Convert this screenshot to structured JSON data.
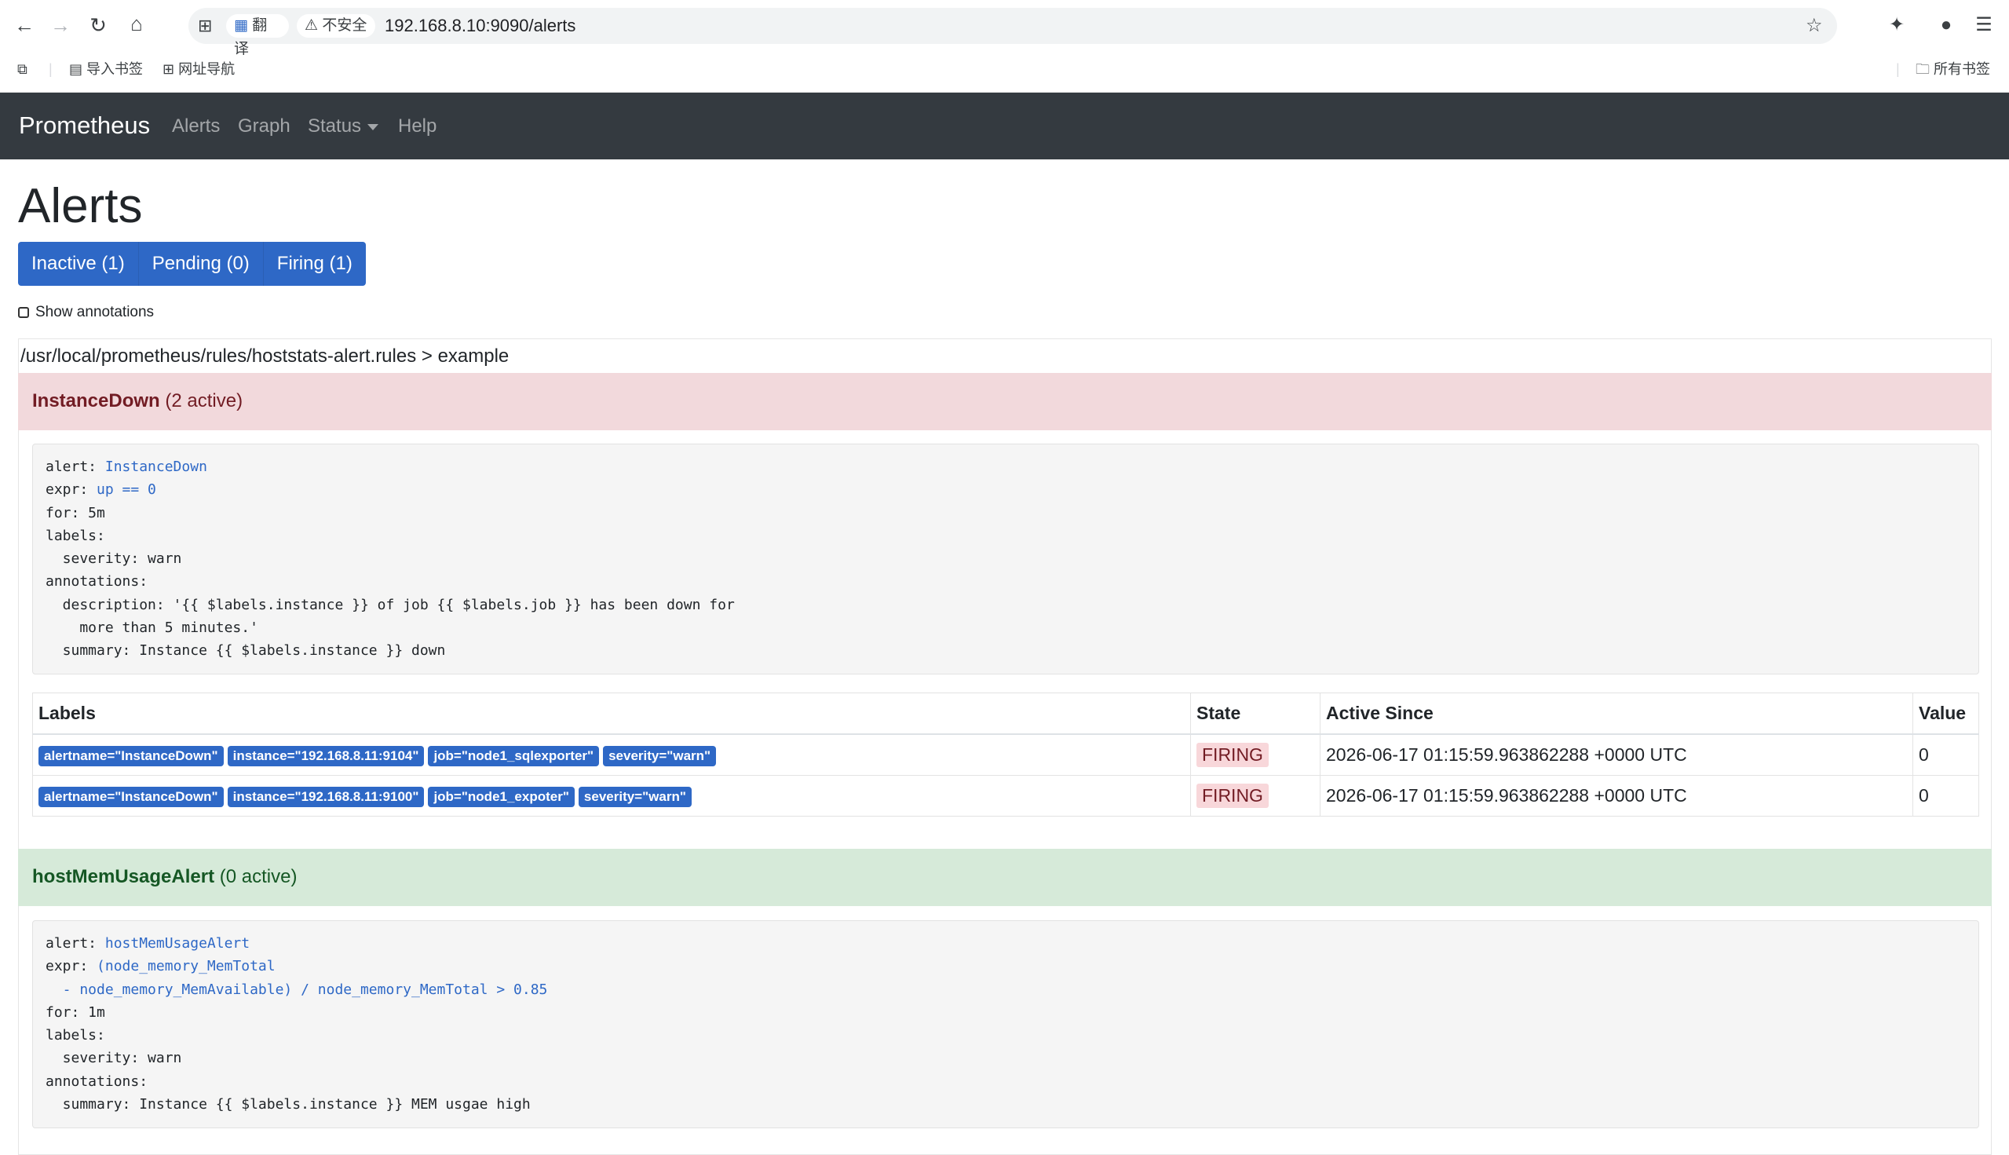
{
  "browser": {
    "translate_label": "翻译",
    "insecure_label": "不安全",
    "url": "192.168.8.10:9090/alerts",
    "bookmarks": [
      {
        "label": "导入书签"
      },
      {
        "label": "网址导航"
      }
    ],
    "all_bookmarks_label": "所有书签"
  },
  "navbar": {
    "brand": "Prometheus",
    "links": [
      "Alerts",
      "Graph",
      "Status",
      "Help"
    ]
  },
  "page": {
    "title": "Alerts",
    "filters": [
      "Inactive (1)",
      "Pending (0)",
      "Firing (1)"
    ],
    "show_annotations_label": "Show annotations"
  },
  "group": {
    "header": "/usr/local/prometheus/rules/hoststats-alert.rules > example"
  },
  "rules": [
    {
      "name": "InstanceDown",
      "active": "(2 active)",
      "code": {
        "alert_key": "alert: ",
        "alert_val": "InstanceDown",
        "expr_key": "expr: ",
        "expr_val": "up == 0",
        "rest": "for: 5m\nlabels:\n  severity: warn\nannotations:\n  description: '{{ $labels.instance }} of job {{ $labels.job }} has been down for\n    more than 5 minutes.'\n  summary: Instance {{ $labels.instance }} down"
      },
      "table": {
        "headers": [
          "Labels",
          "State",
          "Active Since",
          "Value"
        ],
        "rows": [
          {
            "labels": [
              "alertname=\"InstanceDown\"",
              "instance=\"192.168.8.11:9104\"",
              "job=\"node1_sqlexporter\"",
              "severity=\"warn\""
            ],
            "state": "FIRING",
            "active_since": "2026-06-17 01:15:59.963862288 +0000 UTC",
            "value": "0"
          },
          {
            "labels": [
              "alertname=\"InstanceDown\"",
              "instance=\"192.168.8.11:9100\"",
              "job=\"node1_expoter\"",
              "severity=\"warn\""
            ],
            "state": "FIRING",
            "active_since": "2026-06-17 01:15:59.963862288 +0000 UTC",
            "value": "0"
          }
        ]
      }
    },
    {
      "name": "hostMemUsageAlert",
      "active": "(0 active)",
      "code": {
        "alert_key": "alert: ",
        "alert_val": "hostMemUsageAlert",
        "expr_key": "expr: ",
        "expr_val": "(node_memory_MemTotal\n  - node_memory_MemAvailable) / node_memory_MemTotal > 0.85",
        "rest": "for: 1m\nlabels:\n  severity: warn\nannotations:\n  summary: Instance {{ $labels.instance }} MEM usgae high"
      }
    }
  ],
  "colors": {
    "navbar_bg": "#343a40",
    "accent_blue": "#2e68c6",
    "firing_bg": "#f2d9dc",
    "inactive_bg": "#d6ead9"
  }
}
